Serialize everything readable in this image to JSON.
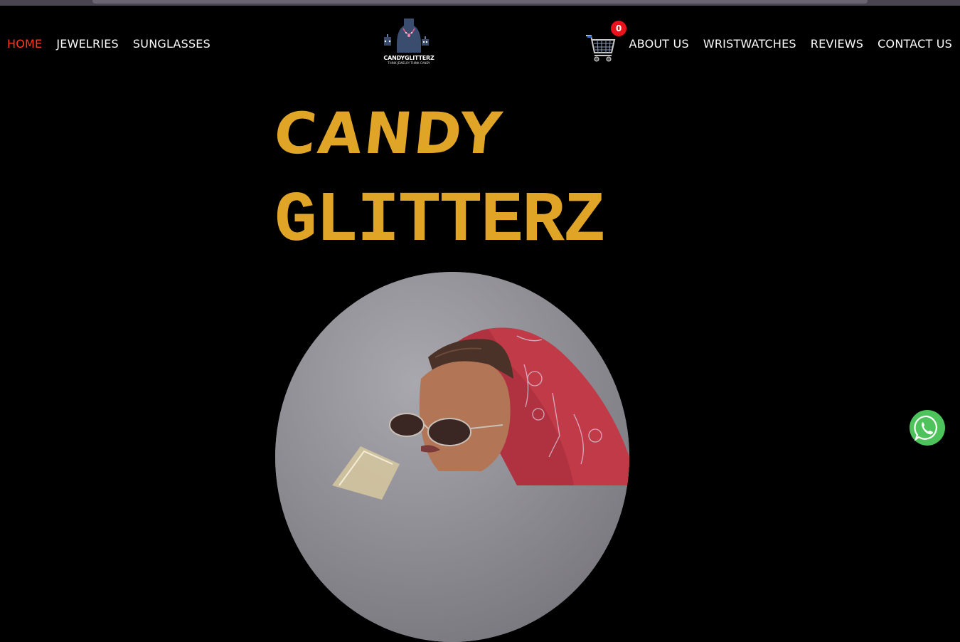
{
  "nav": {
    "left": [
      {
        "label": "HOME",
        "active": true
      },
      {
        "label": "JEWELRIES",
        "active": false
      },
      {
        "label": "SUNGLASSES",
        "active": false
      }
    ],
    "right": [
      {
        "label": "ABOUT US"
      },
      {
        "label": "WRISTWATCHES"
      },
      {
        "label": "REVIEWS"
      },
      {
        "label": "CONTACT US"
      }
    ]
  },
  "cart": {
    "count": "0",
    "icon": "shopping-cart-icon"
  },
  "logo": {
    "name": "CANDYGLITTERZ",
    "tagline": "THINK JEWELRY THINK CANDY"
  },
  "hero": {
    "line1": "CANDY",
    "line2": "GLITTERZ"
  },
  "colors": {
    "accent_gold": "#e0a526",
    "active_nav": "#ff3b1f",
    "badge": "#e8121b",
    "whatsapp": "#4fc35b",
    "background": "#000000"
  },
  "whatsapp": {
    "icon": "whatsapp-icon"
  }
}
